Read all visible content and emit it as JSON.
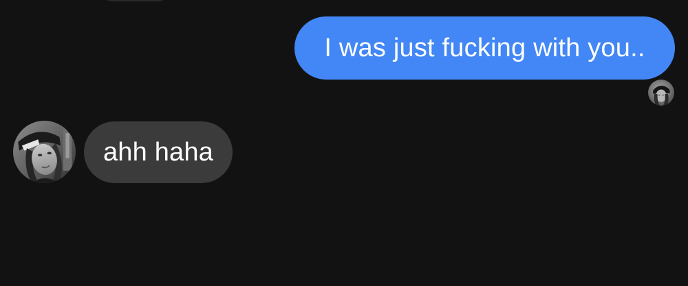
{
  "conversation": {
    "messages": [
      {
        "direction": "sent",
        "text": "I was just fucking with you..",
        "bubble_color": "#4287f5"
      },
      {
        "direction": "received",
        "text": "ahh haha",
        "bubble_color": "#3b3b3b"
      }
    ],
    "background_color": "#121212"
  }
}
